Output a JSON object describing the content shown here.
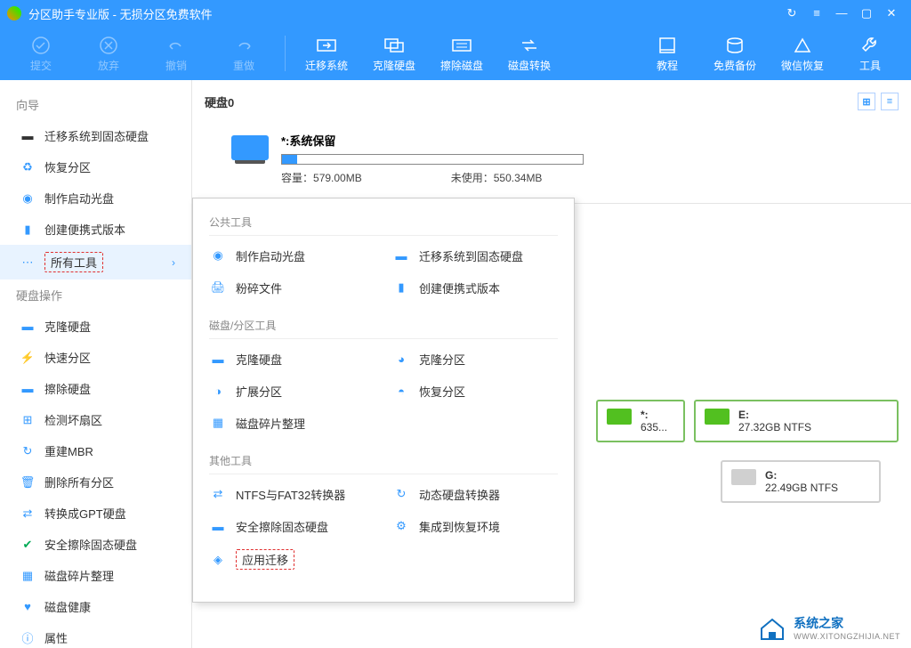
{
  "titlebar": {
    "app": "分区助手专业版",
    "subtitle": "无损分区免费软件"
  },
  "toolbar": {
    "commit": "提交",
    "discard": "放弃",
    "undo": "撤销",
    "redo": "重做",
    "migrate": "迁移系统",
    "clone": "克隆硬盘",
    "wipe": "擦除磁盘",
    "convert": "磁盘转换",
    "tutorial": "教程",
    "backup": "免费备份",
    "wechat": "微信恢复",
    "tools": "工具"
  },
  "sidebar": {
    "wizard": "向导",
    "items1": [
      {
        "label": "迁移系统到固态硬盘"
      },
      {
        "label": "恢复分区"
      },
      {
        "label": "制作启动光盘"
      },
      {
        "label": "创建便携式版本"
      },
      {
        "label": "所有工具"
      }
    ],
    "diskops": "硬盘操作",
    "items2": [
      {
        "label": "克隆硬盘"
      },
      {
        "label": "快速分区"
      },
      {
        "label": "擦除硬盘"
      },
      {
        "label": "检测坏扇区"
      },
      {
        "label": "重建MBR"
      },
      {
        "label": "删除所有分区"
      },
      {
        "label": "转换成GPT硬盘"
      },
      {
        "label": "安全擦除固态硬盘"
      },
      {
        "label": "磁盘碎片整理"
      },
      {
        "label": "磁盘健康"
      },
      {
        "label": "属性"
      }
    ]
  },
  "main": {
    "disk0": "硬盘0",
    "partition": {
      "name": "*:系统保留",
      "capacity_label": "容量：",
      "capacity": "579.00MB",
      "unused_label": "未使用：",
      "unused": "550.34MB",
      "fill_pct": 5
    },
    "row1": [
      {
        "name": "*:",
        "size": "635...",
        "green": true,
        "narrow": true
      },
      {
        "name": "E:",
        "size": "27.32GB NTFS",
        "green": true
      }
    ],
    "row2": [
      {
        "name": "G:",
        "size": "22.49GB NTFS",
        "green": false
      }
    ]
  },
  "popup": {
    "sect1": "公共工具",
    "g1": [
      {
        "label": "制作启动光盘"
      },
      {
        "label": "迁移系统到固态硬盘"
      },
      {
        "label": "粉碎文件"
      },
      {
        "label": "创建便携式版本"
      }
    ],
    "sect2": "磁盘/分区工具",
    "g2": [
      {
        "label": "克隆硬盘"
      },
      {
        "label": "克隆分区"
      },
      {
        "label": "扩展分区"
      },
      {
        "label": "恢复分区"
      },
      {
        "label": "磁盘碎片整理"
      }
    ],
    "sect3": "其他工具",
    "g3": [
      {
        "label": "NTFS与FAT32转换器"
      },
      {
        "label": "动态硬盘转换器"
      },
      {
        "label": "安全擦除固态硬盘"
      },
      {
        "label": "集成到恢复环境"
      },
      {
        "label": "应用迁移",
        "highlight": true
      }
    ]
  },
  "watermark": {
    "brand": "系统之家",
    "url": "WWW.XITONGZHIJIA.NET"
  }
}
